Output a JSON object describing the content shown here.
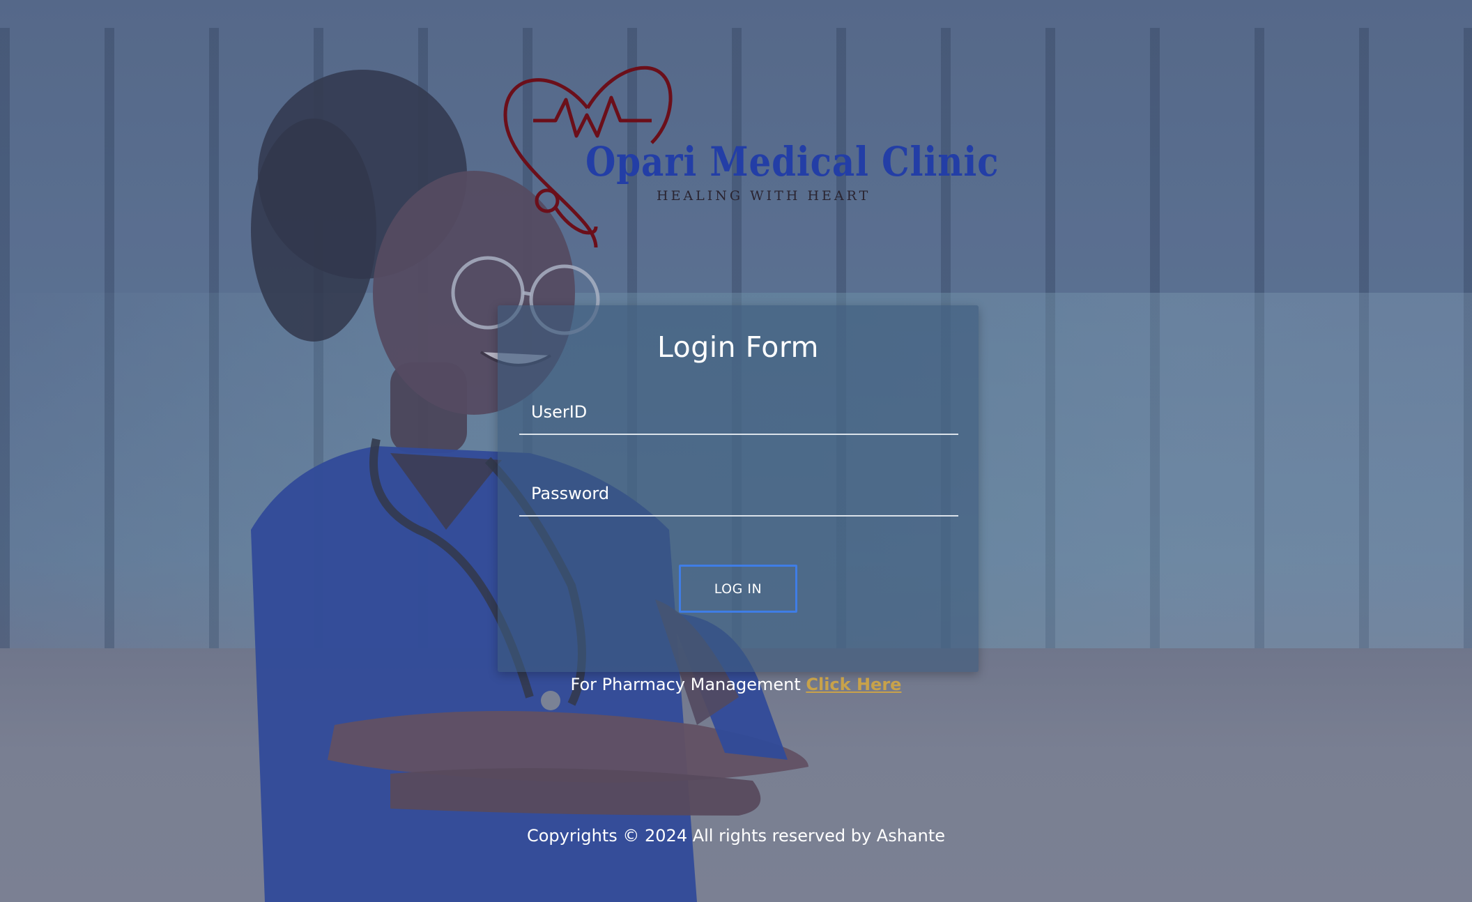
{
  "brand": {
    "name": "Opari Medical Clinic",
    "tagline": "HEALING WITH HEART",
    "logo_icon": "heart-stethoscope-icon",
    "colors": {
      "name": "#233ea6",
      "heart": "#6b0f1a",
      "tagline": "#2a2430"
    }
  },
  "login_form": {
    "title": "Login Form",
    "userid": {
      "placeholder": "UserID",
      "value": ""
    },
    "password": {
      "placeholder": "Password",
      "value": ""
    },
    "submit_label": "LOG IN",
    "button_border_color": "#3f7de6"
  },
  "pharmacy": {
    "prefix": "For Pharmacy Management",
    "link_label": "Click Here",
    "link_color": "#c8a24a"
  },
  "footer": {
    "text": "Copyrights © 2024 All rights reserved by Ashante"
  }
}
